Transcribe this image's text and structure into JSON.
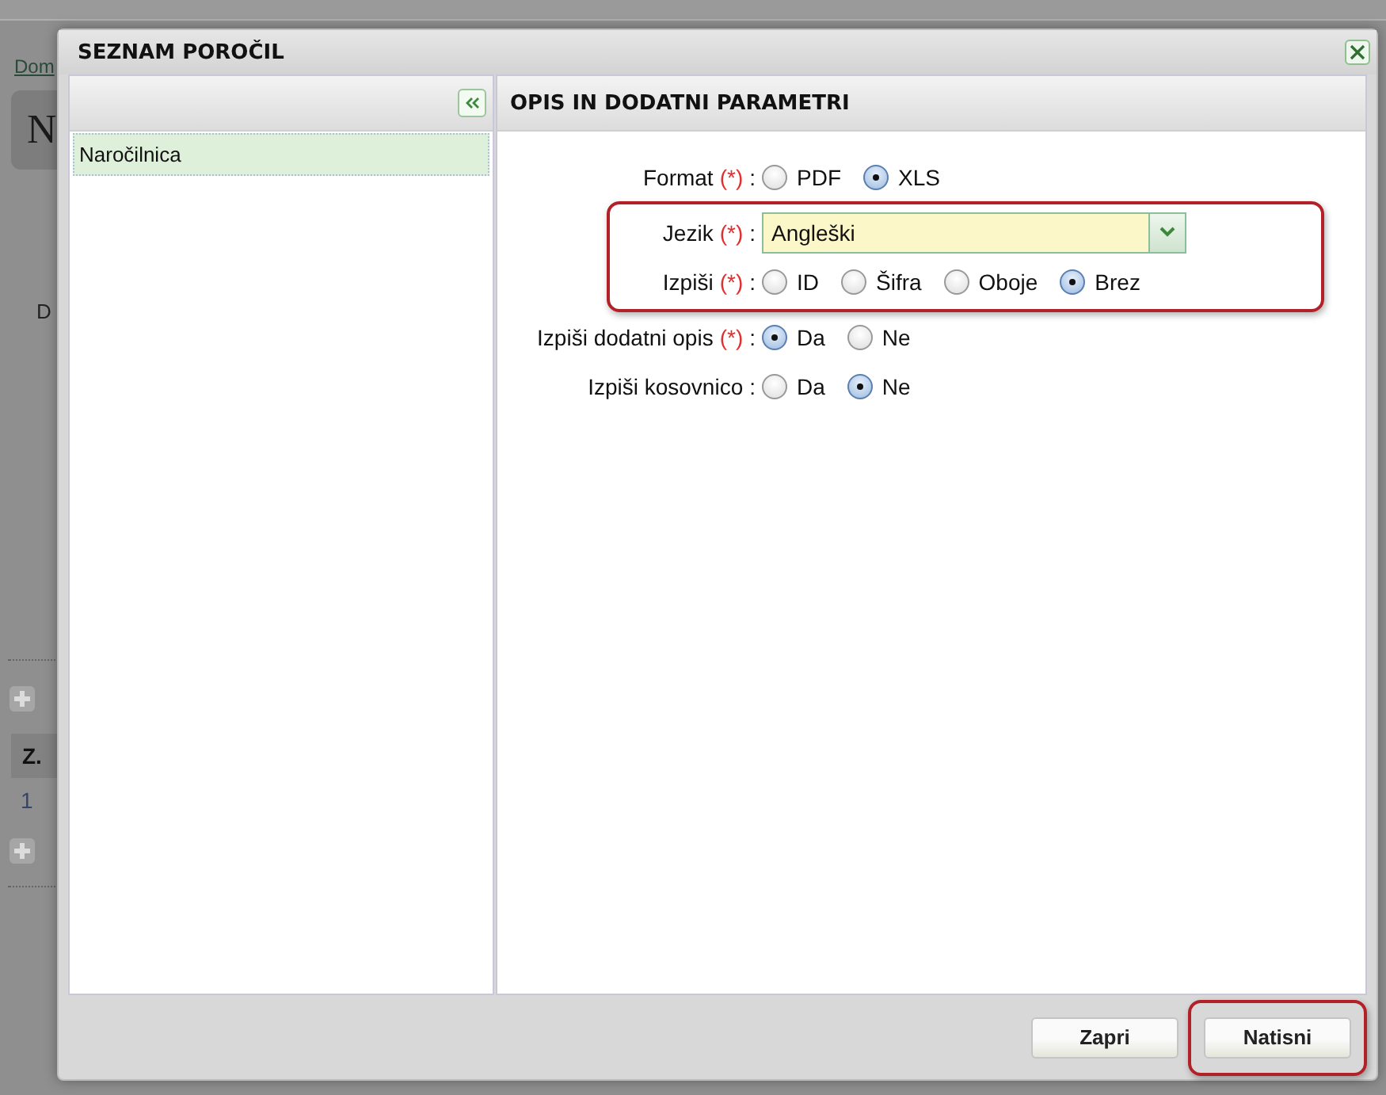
{
  "background": {
    "breadcrumb": "Dom",
    "heading": "N",
    "label": "D",
    "column_header": "Z.",
    "row_number": "1"
  },
  "dialog": {
    "title": "SEZNAM POROČIL",
    "left_panel": {
      "items": [
        {
          "label": "Naročilnica",
          "selected": true
        }
      ]
    },
    "right_panel": {
      "title": "OPIS IN DODATNI PARAMETRI",
      "fields": [
        {
          "kind": "radio",
          "label": "Format",
          "required_mark": "(*)",
          "separator": ":",
          "highlighted": false,
          "options": [
            {
              "label": "PDF",
              "selected": false
            },
            {
              "label": "XLS",
              "selected": true
            }
          ]
        },
        {
          "kind": "select",
          "label": "Jezik",
          "required_mark": "(*)",
          "separator": ":",
          "highlighted": true,
          "value": "Angleški"
        },
        {
          "kind": "radio",
          "label": "Izpiši",
          "required_mark": "(*)",
          "separator": ":",
          "highlighted": true,
          "options": [
            {
              "label": "ID",
              "selected": false
            },
            {
              "label": "Šifra",
              "selected": false
            },
            {
              "label": "Oboje",
              "selected": false
            },
            {
              "label": "Brez",
              "selected": true
            }
          ]
        },
        {
          "kind": "radio",
          "label": "Izpiši dodatni opis",
          "required_mark": "(*)",
          "separator": ":",
          "highlighted": false,
          "options": [
            {
              "label": "Da",
              "selected": true
            },
            {
              "label": "Ne",
              "selected": false
            }
          ]
        },
        {
          "kind": "radio",
          "label": "Izpiši kosovnico",
          "separator": ":",
          "highlighted": false,
          "options": [
            {
              "label": "Da",
              "selected": false
            },
            {
              "label": "Ne",
              "selected": true
            }
          ]
        }
      ]
    },
    "buttons": [
      {
        "label": "Zapri",
        "highlighted": false
      },
      {
        "label": "Natisni",
        "highlighted": true
      }
    ]
  }
}
